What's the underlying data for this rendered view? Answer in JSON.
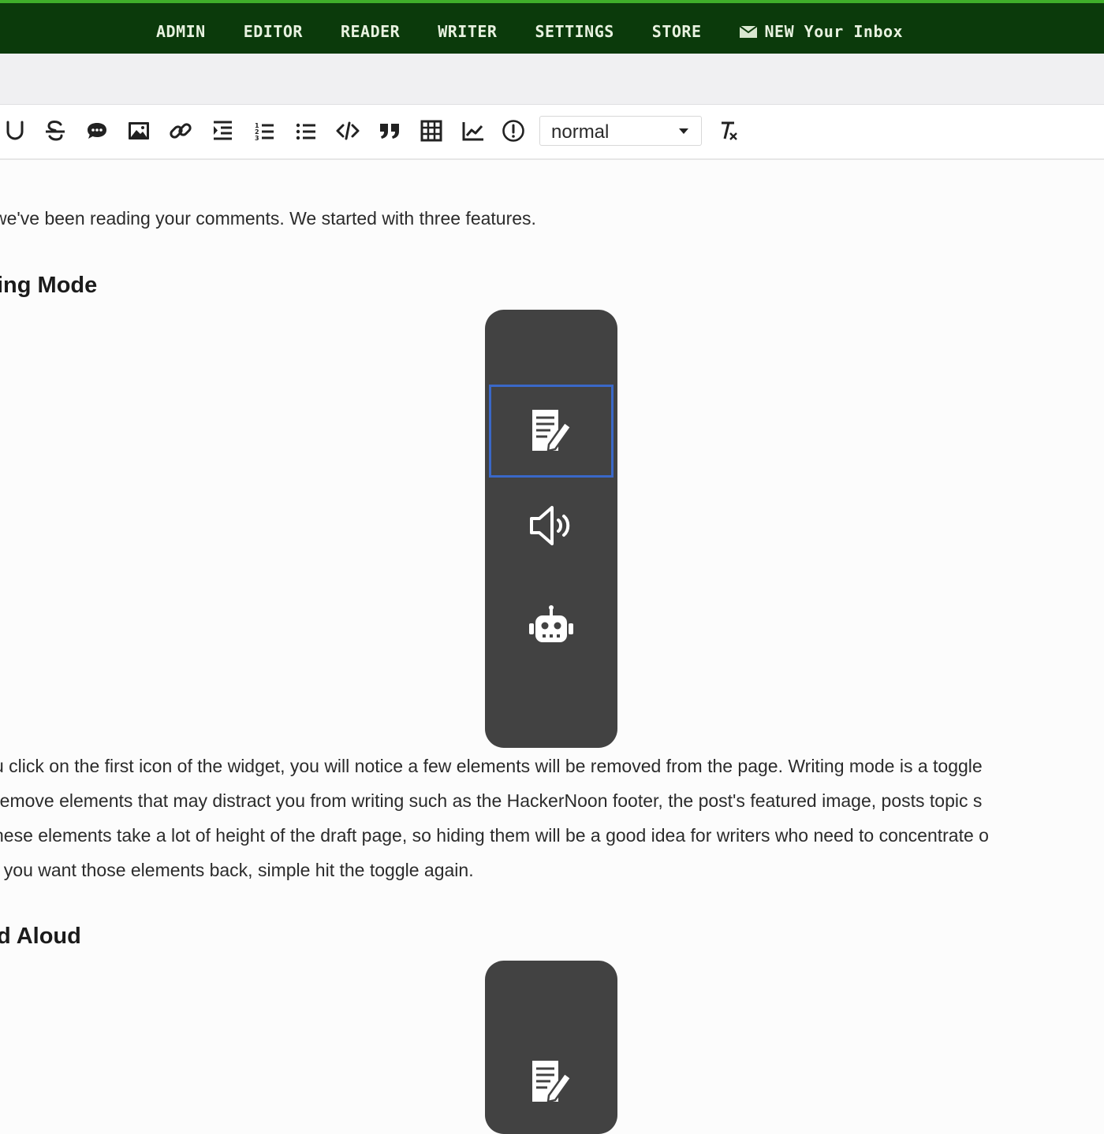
{
  "nav": {
    "links": [
      "ADMIN",
      "EDITOR",
      "READER",
      "WRITER",
      "SETTINGS",
      "STORE"
    ],
    "inbox_label": "NEW Your Inbox",
    "inbox_icon": "mail-icon"
  },
  "toolbar": {
    "buttons": [
      {
        "name": "underline-icon"
      },
      {
        "name": "strikethrough-icon"
      },
      {
        "name": "comment-icon"
      },
      {
        "name": "image-icon"
      },
      {
        "name": "link-icon"
      },
      {
        "name": "indent-icon"
      },
      {
        "name": "ordered-list-icon"
      },
      {
        "name": "bullet-list-icon"
      },
      {
        "name": "code-icon"
      },
      {
        "name": "blockquote-icon"
      },
      {
        "name": "table-icon"
      },
      {
        "name": "chart-icon"
      },
      {
        "name": "info-icon"
      },
      {
        "name": "clear-format-icon"
      }
    ],
    "format_select": "normal"
  },
  "content": {
    "intro": "we've been reading your comments. We started with three features.",
    "heading1": "ing Mode",
    "body_lines": [
      "u click on the first icon of the widget, you will notice a few elements will be removed from the page. Writing mode is a toggle",
      "remove elements that may distract you from writing such as the HackerNoon footer, the post's featured image, posts topic s",
      "hese elements take a lot of height of the draft page, so hiding them will be a good idea for writers who need to concentrate o",
      "f you want those elements back, simple hit the toggle again."
    ],
    "heading2": "d Aloud"
  },
  "widget": {
    "items": [
      "writing-mode-icon",
      "speaker-icon",
      "robot-icon"
    ],
    "selected": "writing-mode-icon"
  },
  "colors": {
    "nav_bg": "#0b3a0b",
    "nav_accent": "#3fae2a",
    "widget_bg": "#424242",
    "selection": "#3a68c8"
  }
}
